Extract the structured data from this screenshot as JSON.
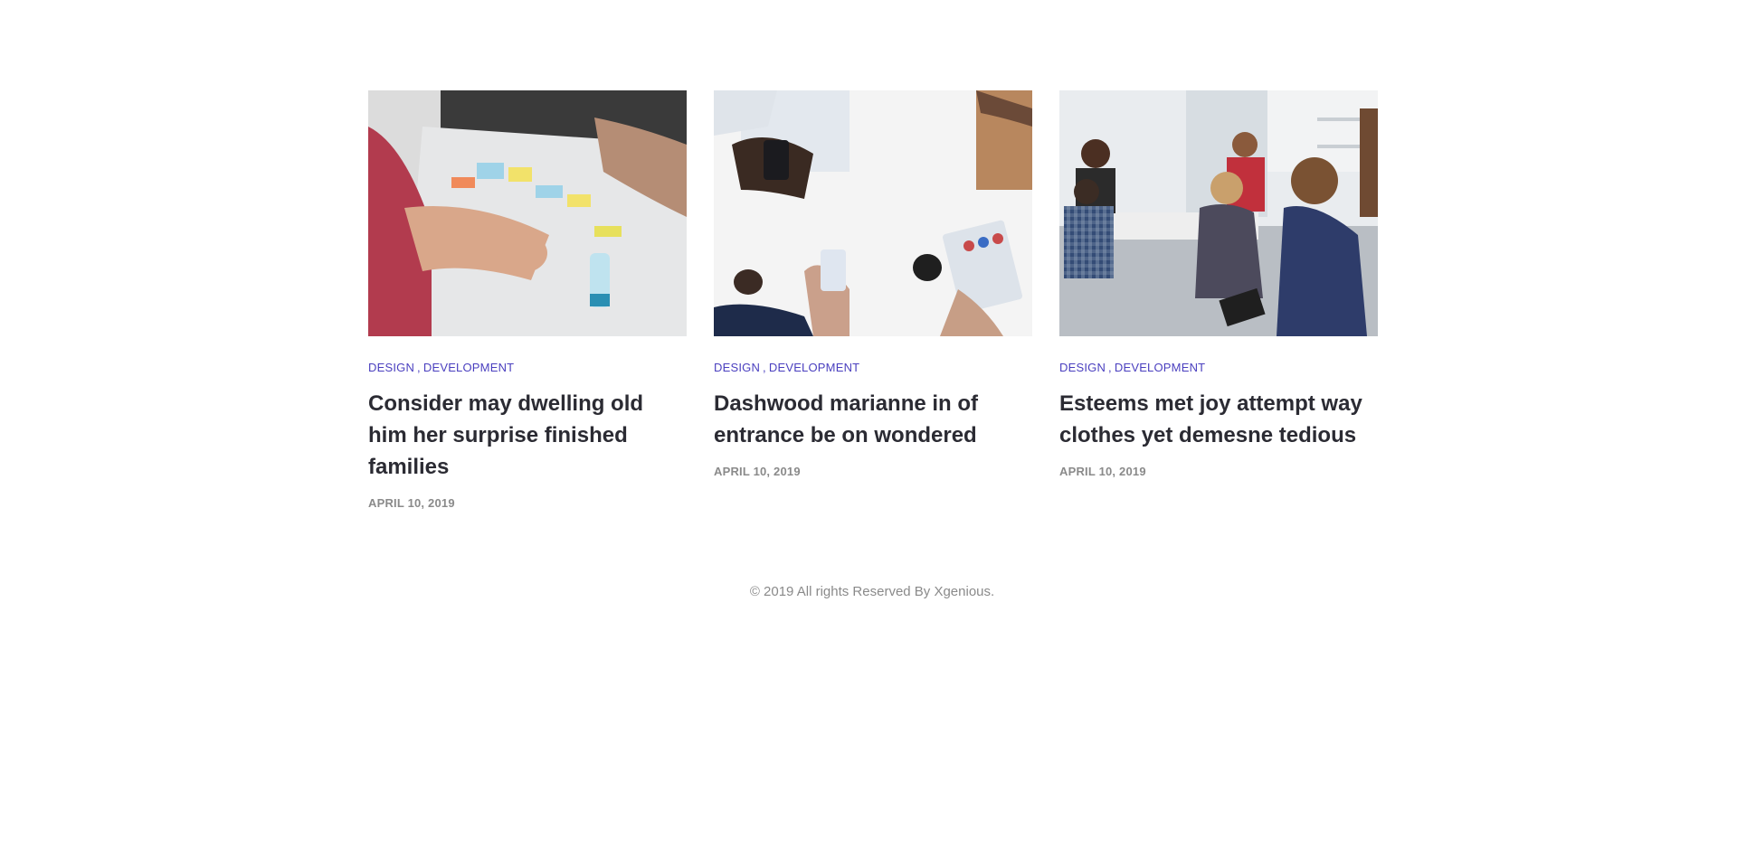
{
  "posts": [
    {
      "image_alt": "Team hands over table with sticky notes",
      "categories": [
        "DESIGN",
        "DEVELOPMENT"
      ],
      "title": "Consider may dwelling old him her surprise finished families",
      "date": "APRIL 10, 2019"
    },
    {
      "image_alt": "Overhead view of people with phones and tablet",
      "categories": [
        "DESIGN",
        "DEVELOPMENT"
      ],
      "title": "Dashwood marianne in of entrance be on wondered",
      "date": "APRIL 10, 2019"
    },
    {
      "image_alt": "Group meeting in office lounge",
      "categories": [
        "DESIGN",
        "DEVELOPMENT"
      ],
      "title": "Esteems met joy attempt way clothes yet demesne tedious",
      "date": "APRIL 10, 2019"
    }
  ],
  "category_separator": ",",
  "footer": {
    "copyright": "© 2019 All rights Reserved By Xgenious."
  },
  "colors": {
    "category": "#4a3fbf",
    "title": "#2b2b33",
    "meta": "#8a8a8a",
    "background": "#ffffff"
  }
}
